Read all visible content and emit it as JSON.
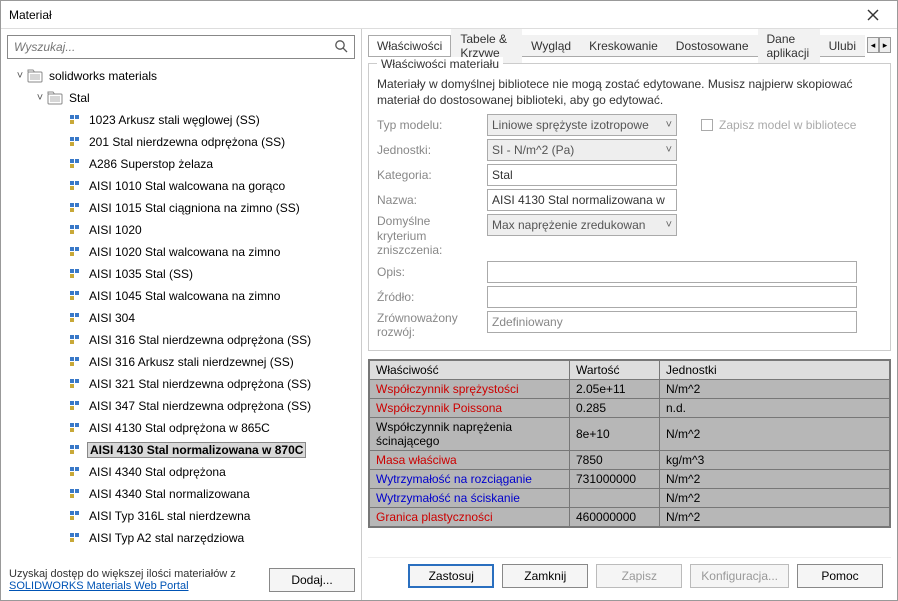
{
  "title": "Materiał",
  "search_placeholder": "Wyszukaj...",
  "tree": {
    "root": "solidworks materials",
    "category": "Stal",
    "items": [
      "1023 Arkusz stali węglowej (SS)",
      "201 Stal nierdzewna odprężona (SS)",
      "A286 Superstop żelaza",
      "AISI 1010 Stal walcowana na gorąco",
      "AISI 1015 Stal ciągniona na zimno (SS)",
      "AISI 1020",
      "AISI 1020 Stal walcowana na zimno",
      "AISI 1035 Stal (SS)",
      "AISI 1045 Stal walcowana na zimno",
      "AISI 304",
      "AISI 316 Stal nierdzewna odprężona (SS)",
      "AISI 316 Arkusz stali nierdzewnej (SS)",
      "AISI 321 Stal nierdzewna odprężona (SS)",
      "AISI 347 Stal nierdzewna odprężona (SS)",
      "AISI 4130 Stal odprężona w 865C",
      "AISI 4130 Stal normalizowana w 870C",
      "AISI 4340 Stal odprężona",
      "AISI 4340 Stal normalizowana",
      "AISI Typ 316L stal nierdzewna",
      "AISI Typ A2 stal narzędziowa"
    ],
    "selected": 15
  },
  "bottom": {
    "text": "Uzyskaj dostęp do większej ilości materiałów z",
    "link": "SOLIDWORKS Materials Web Portal",
    "add": "Dodaj..."
  },
  "tabs": [
    "Właściwości",
    "Tabele & Krzywe",
    "Wygląd",
    "Kreskowanie",
    "Dostosowane",
    "Dane aplikacji",
    "Ulubi"
  ],
  "group": {
    "title": "Właściwości materiału",
    "desc": "Materiały w domyślnej bibliotece nie mogą zostać edytowane. Musisz najpierw skopiować materiał do dostosowanej biblioteki, aby go edytować.",
    "rows": {
      "model": {
        "label": "Typ modelu:",
        "value": "Liniowe sprężyste izotropowe"
      },
      "units": {
        "label": "Jednostki:",
        "value": "SI - N/m^2 (Pa)"
      },
      "category": {
        "label": "Kategoria:",
        "value": "Stal"
      },
      "name": {
        "label": "Nazwa:",
        "value": "AISI 4130 Stal normalizowana w"
      },
      "criterion": {
        "label1": "Domyślne",
        "label2": "kryterium",
        "label3": "zniszczenia:",
        "value": "Max naprężenie zredukowan"
      },
      "desc": {
        "label": "Opis:",
        "value": ""
      },
      "source": {
        "label": "Źródło:",
        "value": ""
      },
      "sustain": {
        "label1": "Zrównoważony",
        "label2": "rozwój:",
        "value": "Zdefiniowany"
      }
    },
    "save_cb": "Zapisz model w bibliotece"
  },
  "table": {
    "headers": [
      "Właściwość",
      "Wartość",
      "Jednostki"
    ],
    "rows": [
      {
        "name": "Współczynnik sprężystości",
        "value": "2.05e+11",
        "unit": "N/m^2",
        "c": "red"
      },
      {
        "name": "Współczynnik Poissona",
        "value": "0.285",
        "unit": "n.d.",
        "c": "red"
      },
      {
        "name": "Współczynnik naprężenia ścinającego",
        "value": "8e+10",
        "unit": "N/m^2",
        "c": ""
      },
      {
        "name": "Masa właściwa",
        "value": "7850",
        "unit": "kg/m^3",
        "c": "red"
      },
      {
        "name": "Wytrzymałość na rozciąganie",
        "value": "731000000",
        "unit": "N/m^2",
        "c": "blue"
      },
      {
        "name": "Wytrzymałość na ściskanie",
        "value": "",
        "unit": "N/m^2",
        "c": "blue"
      },
      {
        "name": "Granica plastyczności",
        "value": "460000000",
        "unit": "N/m^2",
        "c": "red"
      }
    ]
  },
  "buttons": {
    "apply": "Zastosuj",
    "close": "Zamknij",
    "save": "Zapisz",
    "config": "Konfiguracja...",
    "help": "Pomoc"
  }
}
